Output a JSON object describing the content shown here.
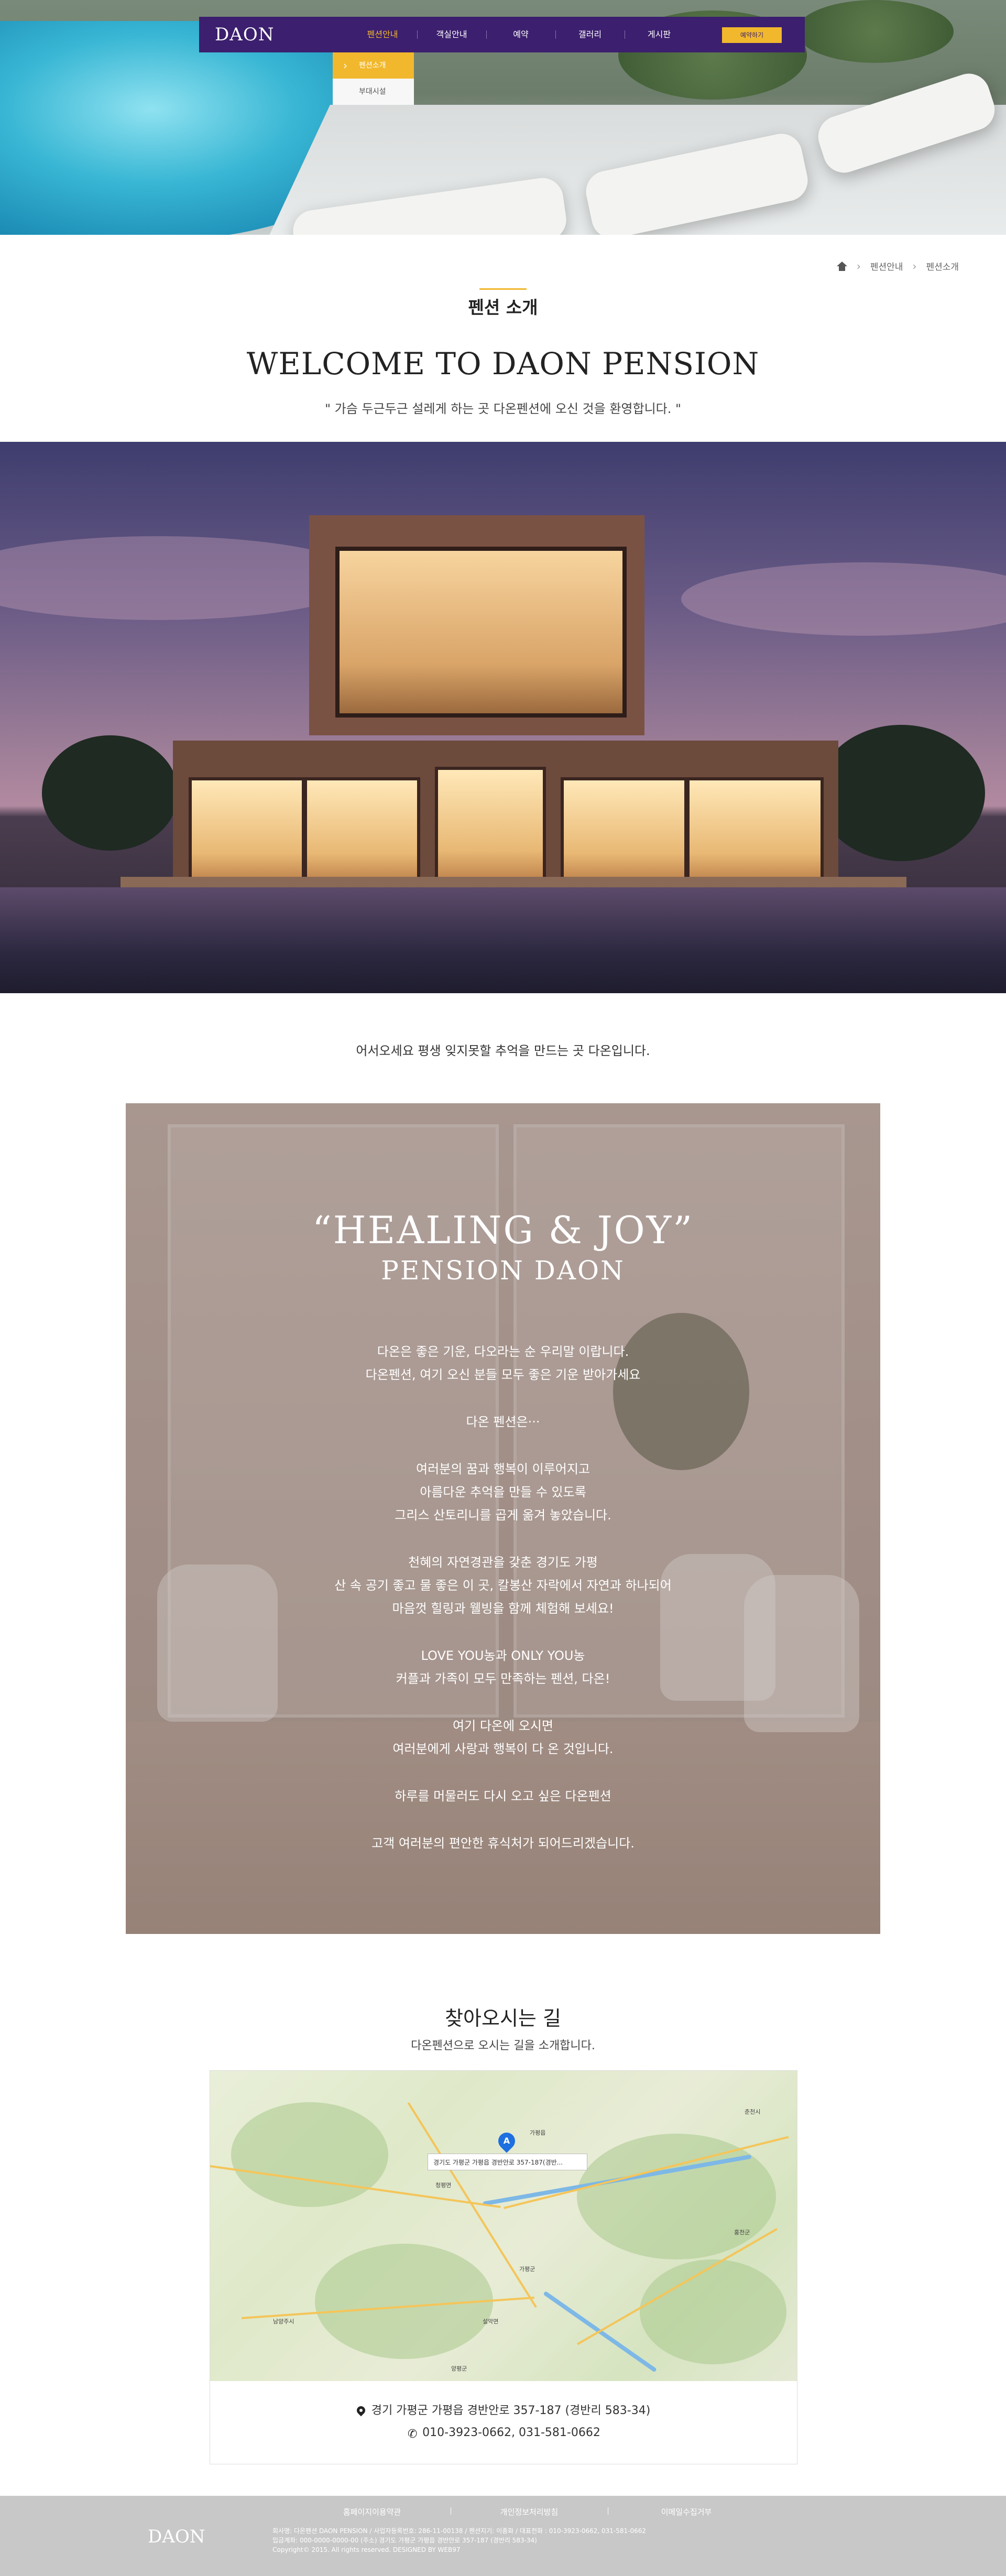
{
  "header": {
    "logo": "DAON",
    "menu": [
      "펜션안내",
      "객실안내",
      "예약",
      "갤러리",
      "게시판"
    ],
    "reserve_label": "예약하기",
    "submenu": [
      "펜션소개",
      "부대시설"
    ]
  },
  "breadcrumb": {
    "items": [
      "펜션안내",
      "펜션소개"
    ]
  },
  "page": {
    "subtitle": "펜션 소개",
    "welcome": "WELCOME  TO DAON PENSION",
    "welcome_sub": "\" 가슴 두근두근 설레게 하는 곳 다온펜션에 오신 것을 환영합니다. \"",
    "intro": "어서오세요 평생 잊지못할 추억을 만드는 곳 다온입니다."
  },
  "healing": {
    "title": "“HEALING & JOY”",
    "subtitle": "PENSION DAON",
    "paragraphs": [
      [
        "다온은 좋은 기운, 다오라는 순 우리말 이랍니다.",
        "다온펜션, 여기 오신 분들 모두 좋은 기운 받아가세요"
      ],
      [
        "다온 펜션은···"
      ],
      [
        "여러분의 꿈과 행복이 이루어지고",
        "아름다운 추억을 만들 수 있도록",
        "그리스 산토리니를 곱게 옮겨 놓았습니다."
      ],
      [
        "천혜의 자연경관을 갖춘 경기도 가평",
        "산 속 공기 좋고 물 좋은 이 곳, 칼봉산 자락에서 자연과 하나되어",
        "마음껏 힐링과 웰빙을 함께 체험해 보세요!"
      ],
      [
        "LOVE YOU농과 ONLY YOU농",
        "커플과 가족이 모두 만족하는 펜션, 다온!"
      ],
      [
        "여기 다온에 오시면",
        "여러분에게 사랑과 행복이 다 온 것입니다."
      ],
      [
        "하루를 머물러도 다시 오고 싶은 다온펜션"
      ],
      [
        "고객 여러분의 편안한 휴식처가 되어드리겠습니다."
      ]
    ]
  },
  "directions": {
    "title": "찾아오시는 길",
    "subtitle": "다온펜션으로 오시는 길을 소개합니다.",
    "map_popup": "경기도 가평군 가평읍 경반안로 357-187(경반...",
    "map_labels": [
      "춘천시",
      "가평군",
      "남양주시",
      "양평군",
      "홍천군",
      "청평면",
      "설악면",
      "가평읍"
    ],
    "address": "경기 가평군 가평읍 경반안로 357-187 (경반리 583-34)",
    "phone": "010-3923-0662, 031-581-0662"
  },
  "footer": {
    "links": [
      "홈페이지이용약관",
      "개인정보처리방침",
      "이메일수집거부"
    ],
    "logo": "DAON",
    "info": [
      "회사명: 다온펜션 DAON PENSION / 사업자등록번호: 286-11-00138 / 펜션지기: 이종화 / 대표전화 : 010-3923-0662, 031-581-0662",
      "입금계좌: 000-0000-0000-00 (주소) 경기도 가평군 가평읍 경반안로 357-187 (경반리 583-34)",
      "Copyright© 2015. All rights reserved. DESIGNED BY WEB97"
    ]
  }
}
